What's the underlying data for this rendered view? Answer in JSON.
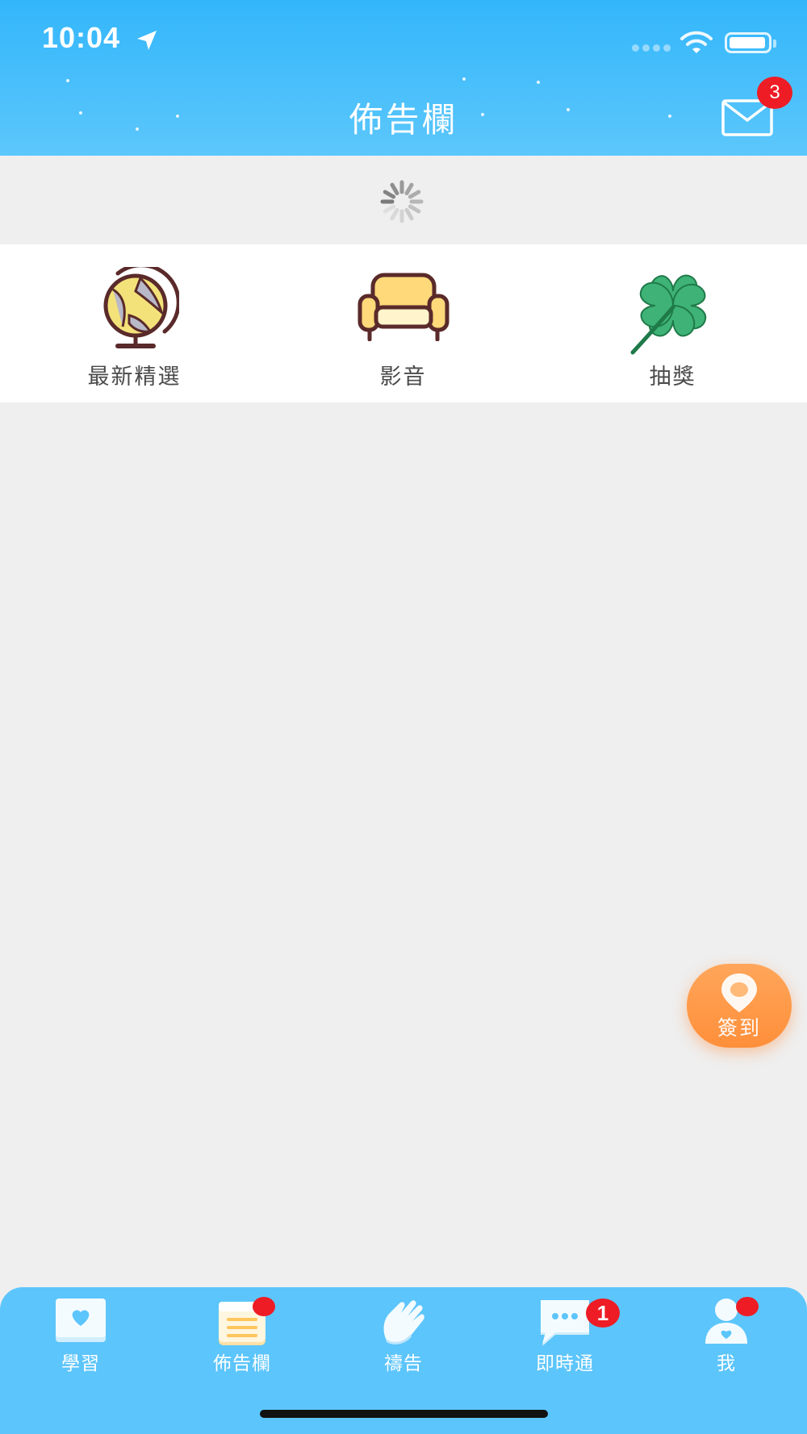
{
  "status_bar": {
    "time": "10:04"
  },
  "header": {
    "title": "佈告欄",
    "mail_badge": "3"
  },
  "categories": [
    {
      "label": "最新精選",
      "icon": "globe-icon"
    },
    {
      "label": "影音",
      "icon": "sofa-icon"
    },
    {
      "label": "抽獎",
      "icon": "clover-icon"
    }
  ],
  "fab": {
    "label": "簽到",
    "icon": "location-pin-icon"
  },
  "tabbar": {
    "items": [
      {
        "label": "學習",
        "icon": "book-heart-icon"
      },
      {
        "label": "佈告欄",
        "icon": "notepad-icon"
      },
      {
        "label": "禱告",
        "icon": "praying-hands-icon"
      },
      {
        "label": "即時通",
        "icon": "chat-bubble-icon",
        "badge": "1"
      },
      {
        "label": "我",
        "icon": "user-icon"
      }
    ]
  },
  "colors": {
    "header_top": "#33b6fb",
    "header_bottom": "#5cc7fb",
    "tabbar": "#5cc5fb",
    "badge": "#ee1c25",
    "fab": "#ff9a48",
    "background": "#efefef"
  }
}
